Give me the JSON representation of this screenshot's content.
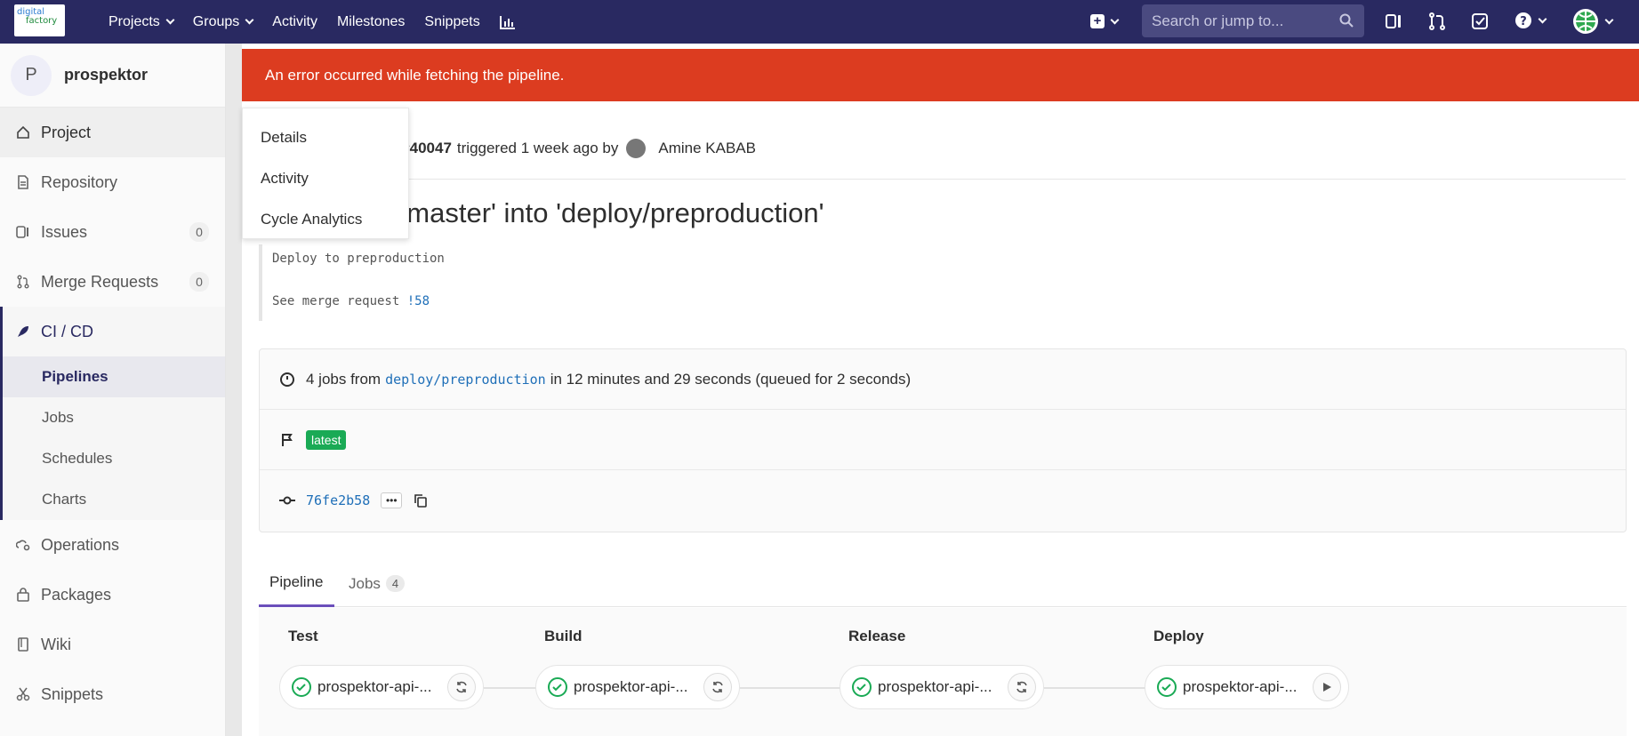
{
  "header": {
    "logo_text_1": "digital",
    "logo_text_2": "factory",
    "nav": [
      {
        "label": "Projects",
        "caret": true
      },
      {
        "label": "Groups",
        "caret": true
      },
      {
        "label": "Activity",
        "caret": false
      },
      {
        "label": "Milestones",
        "caret": false
      },
      {
        "label": "Snippets",
        "caret": false
      }
    ],
    "search_placeholder": "Search or jump to...",
    "color": "#292961"
  },
  "sidebar": {
    "avatar_letter": "P",
    "project_name": "prospektor",
    "items": [
      {
        "label": "Project",
        "icon": "home-icon"
      },
      {
        "label": "Repository",
        "icon": "doc-icon"
      },
      {
        "label": "Issues",
        "icon": "issues-icon",
        "badge": "0"
      },
      {
        "label": "Merge Requests",
        "icon": "merge-icon",
        "badge": "0"
      }
    ],
    "cicd": {
      "label": "CI / CD",
      "subitems": [
        "Pipelines",
        "Jobs",
        "Schedules",
        "Charts"
      ]
    },
    "items_after": [
      {
        "label": "Operations",
        "icon": "cloud-gear-icon"
      },
      {
        "label": "Packages",
        "icon": "package-icon"
      },
      {
        "label": "Wiki",
        "icon": "book-icon"
      },
      {
        "label": "Snippets",
        "icon": "scissors-icon"
      }
    ]
  },
  "alert": {
    "text": "An error occurred while fetching the pipeline.",
    "color": "#dc3c20"
  },
  "dropdown": {
    "items": [
      "Details",
      "Activity",
      "Cycle Analytics"
    ]
  },
  "pipeline": {
    "id_partial": "e #40047",
    "triggered": "triggered 1 week ago by",
    "user": "Amine KABAB",
    "commit_title_partial": "ch 'master' into 'deploy/preproduction'",
    "desc_line1": "Deploy to preproduction",
    "desc_line2_prefix": "See merge request",
    "desc_line2_link": "!58",
    "jobs_prefix": "4 jobs from",
    "branch": "deploy/preproduction",
    "jobs_suffix": "in 12 minutes and 29 seconds (queued for 2 seconds)",
    "tag": "latest",
    "sha": "76fe2b58"
  },
  "tabs": [
    {
      "label": "Pipeline",
      "active": true
    },
    {
      "label": "Jobs",
      "count": "4"
    }
  ],
  "stages": [
    {
      "title": "Test",
      "job": "prospektor-api-...",
      "action": "retry"
    },
    {
      "title": "Build",
      "job": "prospektor-api-...",
      "action": "retry"
    },
    {
      "title": "Release",
      "job": "prospektor-api-...",
      "action": "retry"
    },
    {
      "title": "Deploy",
      "job": "prospektor-api-...",
      "action": "play"
    }
  ]
}
